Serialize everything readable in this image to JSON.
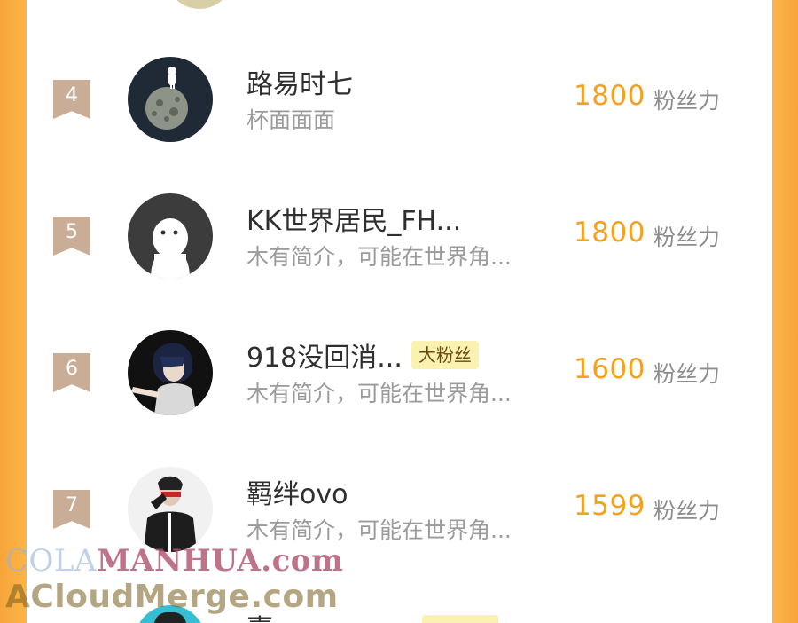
{
  "list": {
    "rows": [
      {
        "rank": "4",
        "rank_color": "#c9ad96",
        "name": "路易时七",
        "badge": "",
        "bio": "杯面面面",
        "score": "1800",
        "unit": "粉丝力",
        "avatar": "astronaut-on-moon-avatar"
      },
      {
        "rank": "5",
        "rank_color": "#c9ad96",
        "name": "KK世界居民_FH...",
        "badge": "",
        "bio": "木有简介，可能在世界角...",
        "score": "1800",
        "unit": "粉丝力",
        "avatar": "default-ghost-avatar"
      },
      {
        "rank": "6",
        "rank_color": "#c9ad96",
        "name": "918没回消...",
        "badge": "大粉丝",
        "bio": "木有简介，可能在世界角...",
        "score": "1600",
        "unit": "粉丝力",
        "avatar": "anime-character-avatar"
      },
      {
        "rank": "7",
        "rank_color": "#c9ad96",
        "name": "羁绊ovo",
        "badge": "",
        "bio": "木有简介，可能在世界角...",
        "score": "1599",
        "unit": "粉丝力",
        "avatar": "person-in-black-avatar"
      }
    ],
    "partial_next_name": "嘉…"
  },
  "watermark": {
    "line1_a": "COLA",
    "line1_b": "MANHUA.com",
    "line2": "ACloudMerge.com"
  },
  "colors": {
    "accent": "#f4a11f",
    "background_orange": "#fbb446",
    "badge_bg": "#fbf1b0"
  }
}
